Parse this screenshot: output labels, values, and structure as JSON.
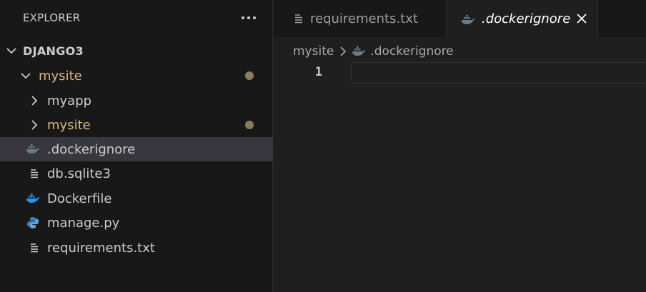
{
  "explorer": {
    "title": "EXPLORER",
    "more_icon": "ellipsis-icon",
    "root_label": "DJANGO3",
    "items": [
      {
        "label": "mysite",
        "kind": "folder",
        "expanded": true,
        "modified": true
      },
      {
        "label": "myapp",
        "kind": "folder",
        "expanded": false,
        "modified": false
      },
      {
        "label": "mysite",
        "kind": "folder",
        "expanded": false,
        "modified": true
      },
      {
        "label": ".dockerignore",
        "kind": "file",
        "icon": "docker-icon",
        "selected": true
      },
      {
        "label": "db.sqlite3",
        "kind": "file",
        "icon": "text-lines-icon"
      },
      {
        "label": "Dockerfile",
        "kind": "file",
        "icon": "docker-icon"
      },
      {
        "label": "manage.py",
        "kind": "file",
        "icon": "python-icon"
      },
      {
        "label": "requirements.txt",
        "kind": "file",
        "icon": "text-lines-icon"
      }
    ]
  },
  "tabs": [
    {
      "label": "requirements.txt",
      "icon": "text-lines-icon",
      "active": false
    },
    {
      "label": ".dockerignore",
      "icon": "docker-icon",
      "active": true,
      "close_icon": "close-icon"
    }
  ],
  "breadcrumb": {
    "folder": "mysite",
    "separator_icon": "chevron-right-icon",
    "file": ".dockerignore"
  },
  "editor": {
    "line_numbers": [
      "1"
    ],
    "content": ""
  },
  "colors": {
    "modified_text": "#d7ba7d",
    "modified_dot": "#8c7c5a",
    "selection_bg": "#37373d",
    "docker_blue": "#2496ed",
    "docker_grey": "#6b7b86"
  }
}
